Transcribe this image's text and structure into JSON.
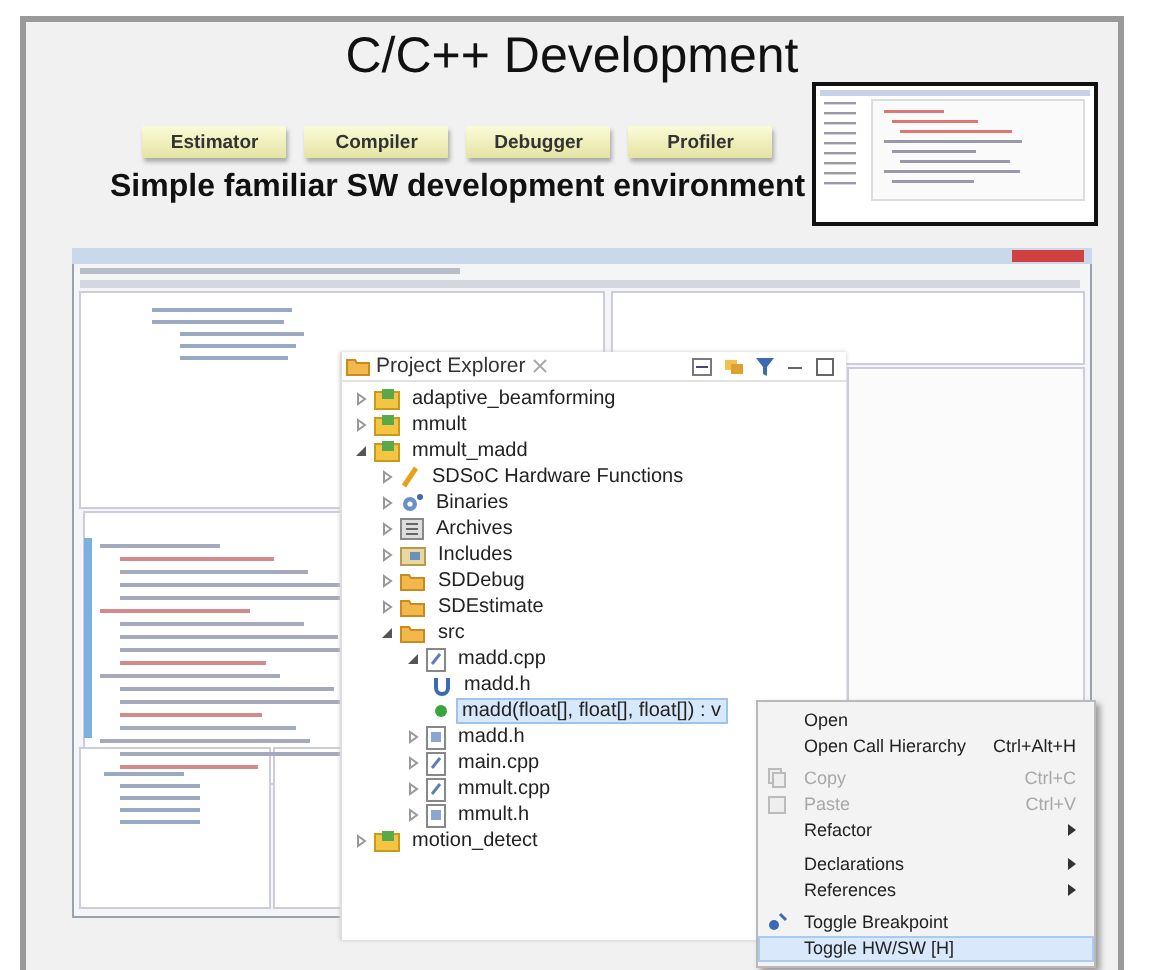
{
  "slide": {
    "title": "C/C++ Development",
    "buttons": [
      "Estimator",
      "Compiler",
      "Debugger",
      "Profiler"
    ],
    "subtitle": "Simple familiar SW development environment"
  },
  "project_explorer": {
    "title": "Project Explorer",
    "tree": [
      {
        "label": "adaptive_beamforming",
        "kind": "project",
        "expanded": false,
        "selected": false
      },
      {
        "label": "mmult",
        "kind": "project",
        "expanded": false,
        "selected": false
      },
      {
        "label": "mmult_madd",
        "kind": "project",
        "expanded": true,
        "selected": false,
        "children": [
          {
            "label": "SDSoC Hardware Functions",
            "kind": "hardware",
            "expanded": false,
            "selected": false
          },
          {
            "label": "Binaries",
            "kind": "binaries",
            "expanded": false,
            "selected": false
          },
          {
            "label": "Archives",
            "kind": "archives",
            "expanded": false,
            "selected": false
          },
          {
            "label": "Includes",
            "kind": "includes",
            "expanded": false,
            "selected": false
          },
          {
            "label": "SDDebug",
            "kind": "folder",
            "expanded": false,
            "selected": false
          },
          {
            "label": "SDEstimate",
            "kind": "folder",
            "expanded": false,
            "selected": false
          },
          {
            "label": "src",
            "kind": "folder",
            "expanded": true,
            "selected": false,
            "children": [
              {
                "label": "madd.cpp",
                "kind": "source",
                "expanded": true,
                "selected": false,
                "children": [
                  {
                    "label": "madd.h",
                    "kind": "include",
                    "selected": false
                  },
                  {
                    "label": "madd(float[], float[], float[]) : v",
                    "kind": "function",
                    "selected": true
                  }
                ]
              },
              {
                "label": "madd.h",
                "kind": "header",
                "expanded": false,
                "selected": false
              },
              {
                "label": "main.cpp",
                "kind": "source",
                "expanded": false,
                "selected": false
              },
              {
                "label": "mmult.cpp",
                "kind": "source",
                "expanded": false,
                "selected": false
              },
              {
                "label": "mmult.h",
                "kind": "header",
                "expanded": false,
                "selected": false
              }
            ]
          }
        ]
      },
      {
        "label": "motion_detect",
        "kind": "project",
        "expanded": false,
        "selected": false
      }
    ]
  },
  "context_menu": {
    "items": [
      {
        "kind": "item",
        "label": "Open",
        "disabled": false,
        "selected": false
      },
      {
        "kind": "item",
        "label": "Open Call Hierarchy",
        "shortcut": "Ctrl+Alt+H",
        "disabled": false,
        "selected": false
      },
      {
        "kind": "separator"
      },
      {
        "kind": "copy",
        "label": "Copy",
        "shortcut": "Ctrl+C",
        "disabled": true,
        "selected": false
      },
      {
        "kind": "paste",
        "label": "Paste",
        "shortcut": "Ctrl+V",
        "disabled": true,
        "selected": false
      },
      {
        "kind": "item",
        "label": "Refactor",
        "submenu": true,
        "disabled": false,
        "selected": false
      },
      {
        "kind": "separator"
      },
      {
        "kind": "item",
        "label": "Declarations",
        "submenu": true,
        "disabled": false,
        "selected": false
      },
      {
        "kind": "item",
        "label": "References",
        "submenu": true,
        "disabled": false,
        "selected": false
      },
      {
        "kind": "separator"
      },
      {
        "kind": "breakpoint",
        "label": "Toggle Breakpoint",
        "disabled": false,
        "selected": false
      },
      {
        "kind": "item",
        "label": "Toggle HW/SW [H]",
        "disabled": false,
        "selected": true
      }
    ]
  }
}
